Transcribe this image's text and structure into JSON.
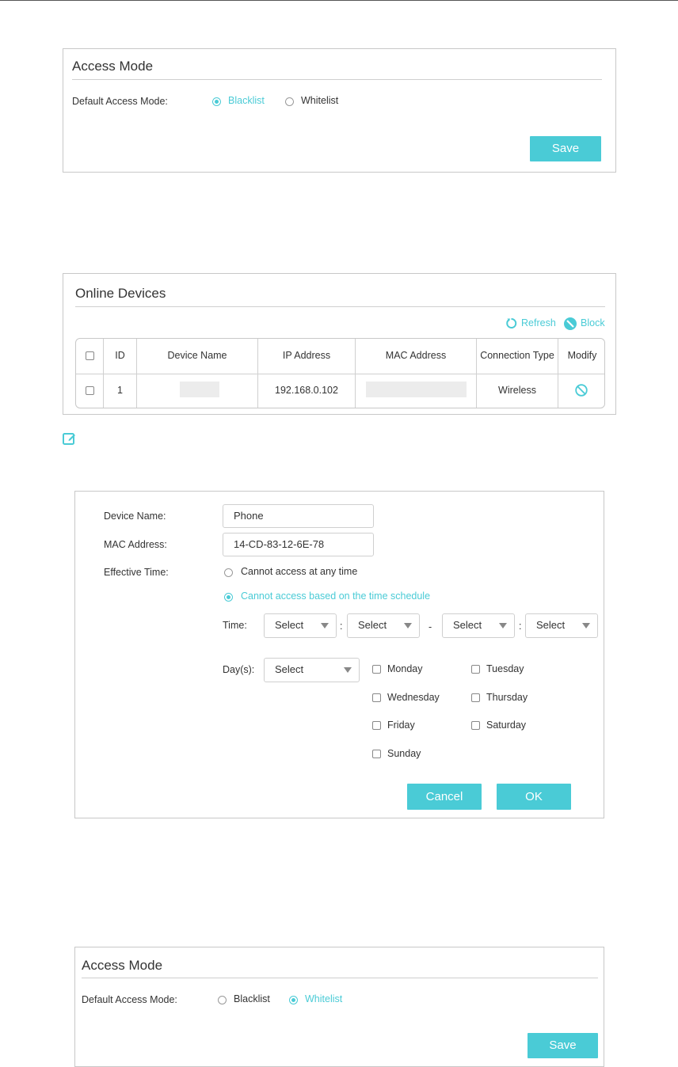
{
  "access_mode_1": {
    "title": "Access Mode",
    "field_label": "Default Access Mode:",
    "options": [
      {
        "label": "Blacklist",
        "selected": true
      },
      {
        "label": "Whitelist",
        "selected": false
      }
    ],
    "save_label": "Save"
  },
  "online_devices": {
    "title": "Online Devices",
    "refresh_label": "Refresh",
    "block_label": "Block",
    "columns": [
      "ID",
      "Device Name",
      "IP Address",
      "MAC Address",
      "Connection Type",
      "Modify"
    ],
    "rows": [
      {
        "id": "1",
        "device_name": "",
        "ip": "192.168.0.102",
        "mac": "",
        "connection": "Wireless"
      }
    ]
  },
  "device_form": {
    "device_name_label": "Device Name:",
    "device_name_value": "Phone",
    "mac_label": "MAC Address:",
    "mac_value": "14-CD-83-12-6E-78",
    "effective_time_label": "Effective Time:",
    "option_any_time": "Cannot access at any time",
    "option_schedule": "Cannot access based on the time schedule",
    "time_label": "Time:",
    "select_placeholder": "Select",
    "colon": ":",
    "dash": "-",
    "days_label": "Day(s):",
    "days": [
      "Monday",
      "Tuesday",
      "Wednesday",
      "Thursday",
      "Friday",
      "Saturday",
      "Sunday"
    ],
    "cancel_label": "Cancel",
    "ok_label": "OK"
  },
  "access_mode_2": {
    "title": "Access Mode",
    "field_label": "Default Access Mode:",
    "options": [
      {
        "label": "Blacklist",
        "selected": false
      },
      {
        "label": "Whitelist",
        "selected": true
      }
    ],
    "save_label": "Save"
  },
  "colors": {
    "accent": "#4acbd6",
    "border": "#c8c8c8",
    "text": "#333333"
  }
}
